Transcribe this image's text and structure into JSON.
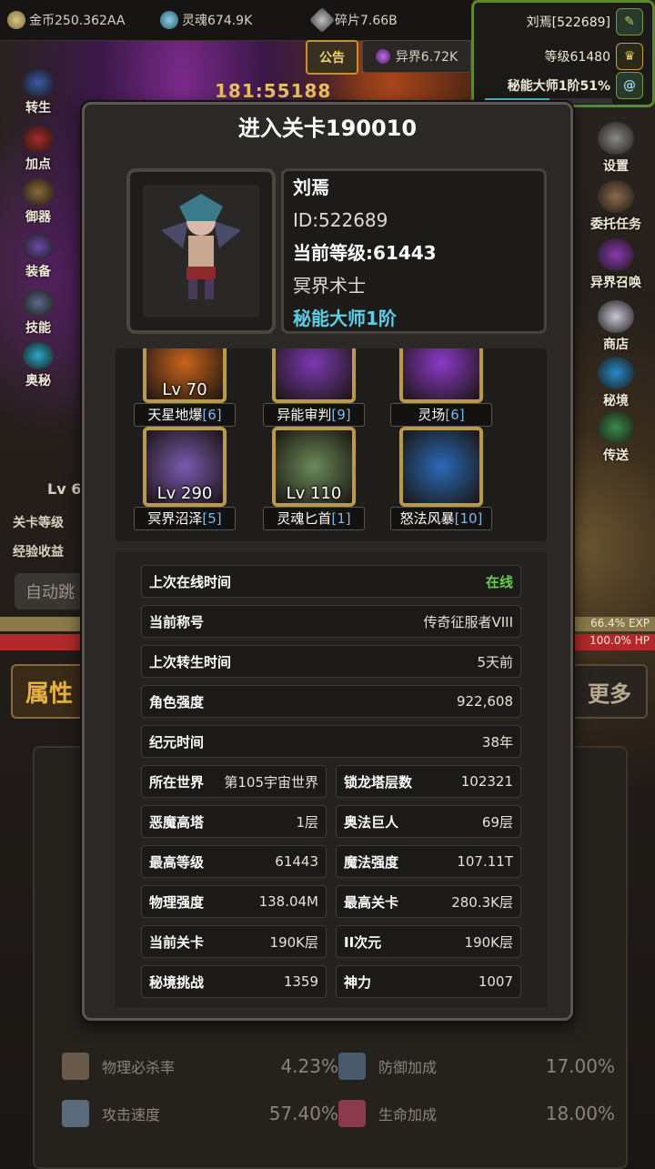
{
  "topbar": {
    "coins": "金币250.362AA",
    "soul": "灵魂674.9K",
    "fragments": "碎片7.66B"
  },
  "player_panel": {
    "name": "刘焉[522689]",
    "level": "等级61480",
    "rank": "秘能大师1阶51%",
    "rank_progress": 0.51
  },
  "notice_button": "公告",
  "other_world": "异界6.72K",
  "timer_text": "181:55188",
  "left_menu": [
    "转生",
    "加点",
    "御器",
    "装备",
    "技能",
    "奥秘"
  ],
  "right_menu": [
    "设置",
    "委托任务",
    "异界召唤",
    "商店",
    "秘境",
    "传送"
  ],
  "background": {
    "stage_level_label": "关卡等级",
    "exp_income_label": "经验收益",
    "auto_skip": "自动跳",
    "char_level": "Lv 6",
    "exp_percent": "66.4% EXP",
    "hp_percent": "100.0% HP",
    "tab_attributes": "属性",
    "tab_more": "更多",
    "stats": [
      {
        "label": "物理必杀率",
        "value": "4.23%"
      },
      {
        "label": "防御加成",
        "value": "17.00%"
      },
      {
        "label": "攻击速度",
        "value": "57.40%"
      },
      {
        "label": "生命加成",
        "value": "18.00%"
      }
    ]
  },
  "modal": {
    "title": "进入关卡190010",
    "info": {
      "name": "刘焉",
      "id": "ID:522689",
      "level": "当前等级:61443",
      "class": "冥界术士",
      "rank": "秘能大师1阶"
    },
    "skills": [
      {
        "lv": "Lv 70",
        "name": "天星地爆",
        "level": "[6]",
        "color": "#c8641c"
      },
      {
        "lv": "",
        "name": "异能审判",
        "level": "[9]",
        "color": "#7a3ab0"
      },
      {
        "lv": "",
        "name": "灵场",
        "level": "[6]",
        "color": "#8a3ac8"
      },
      {
        "lv": "Lv 290",
        "name": "冥界沼泽",
        "level": "[5]",
        "color": "#7a5ab0"
      },
      {
        "lv": "Lv 110",
        "name": "灵魂匕首",
        "level": "[1]",
        "color": "#6a8a5a"
      },
      {
        "lv": "",
        "name": "怒法风暴",
        "level": "[10]",
        "color": "#2a6ab8"
      }
    ],
    "rows_full": [
      {
        "k": "上次在线时间",
        "v": "在线",
        "green": true
      },
      {
        "k": "当前称号",
        "v": "传奇征服者VIII"
      },
      {
        "k": "上次转生时间",
        "v": "5天前"
      },
      {
        "k": "角色强度",
        "v": "922,608"
      },
      {
        "k": "纪元时间",
        "v": "38年"
      }
    ],
    "rows_grid": [
      {
        "k": "所在世界",
        "v": "第105宇宙世界"
      },
      {
        "k": "锁龙塔层数",
        "v": "102321"
      },
      {
        "k": "恶魔高塔",
        "v": "1层"
      },
      {
        "k": "奥法巨人",
        "v": "69层"
      },
      {
        "k": "最高等级",
        "v": "61443"
      },
      {
        "k": "魔法强度",
        "v": "107.11T"
      },
      {
        "k": "物理强度",
        "v": "138.04M"
      },
      {
        "k": "最高关卡",
        "v": "280.3K层"
      },
      {
        "k": "当前关卡",
        "v": "190K层"
      },
      {
        "k": "II次元",
        "v": "190K层"
      },
      {
        "k": "秘境挑战",
        "v": "1359"
      },
      {
        "k": "神力",
        "v": "1007"
      }
    ]
  }
}
